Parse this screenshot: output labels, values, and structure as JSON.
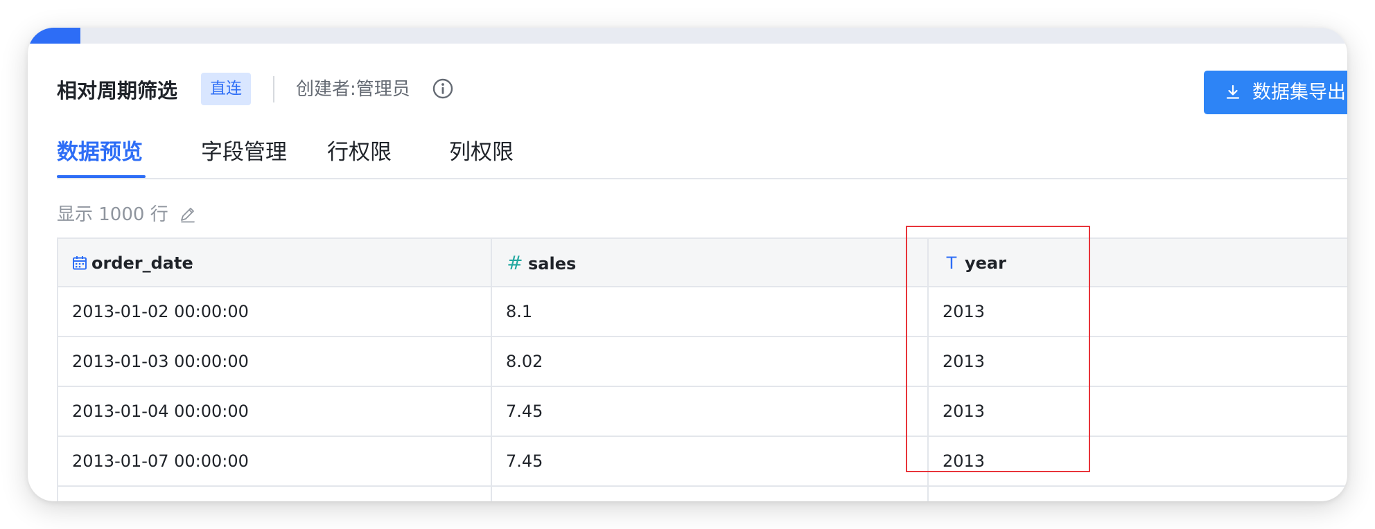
{
  "colors": {
    "primary": "#2d6df6",
    "button": "#2d84f6",
    "badge_bg": "#d9e6ff",
    "highlight": "#e8343a"
  },
  "progress": 0.04,
  "dataset": {
    "title": "相对周期筛选",
    "badge": "直连",
    "creator": "创建者:管理员",
    "info_icon": "info-circle-icon"
  },
  "export_button": {
    "icon": "download-icon",
    "label": "数据集导出"
  },
  "tabs": [
    {
      "label": "数据预览",
      "active": true
    },
    {
      "label": "字段管理",
      "active": false
    },
    {
      "label": "行权限",
      "active": false
    },
    {
      "label": "列权限",
      "active": false
    }
  ],
  "rows_info": {
    "label": "显示 1000 行",
    "edit_icon": "edit-pencil-icon"
  },
  "table": {
    "columns": [
      {
        "name": "order_date",
        "type_icon": "calendar-icon"
      },
      {
        "name": "sales",
        "type_icon": "hash-icon",
        "type_glyph": "#"
      },
      {
        "name": "year",
        "type_icon": "text-type-icon",
        "type_glyph": "T"
      }
    ],
    "rows": [
      [
        "2013-01-02 00:00:00",
        "8.1",
        "2013"
      ],
      [
        "2013-01-03 00:00:00",
        "8.02",
        "2013"
      ],
      [
        "2013-01-04 00:00:00",
        "7.45",
        "2013"
      ],
      [
        "2013-01-07 00:00:00",
        "7.45",
        "2013"
      ],
      [
        "",
        "",
        ""
      ]
    ]
  }
}
